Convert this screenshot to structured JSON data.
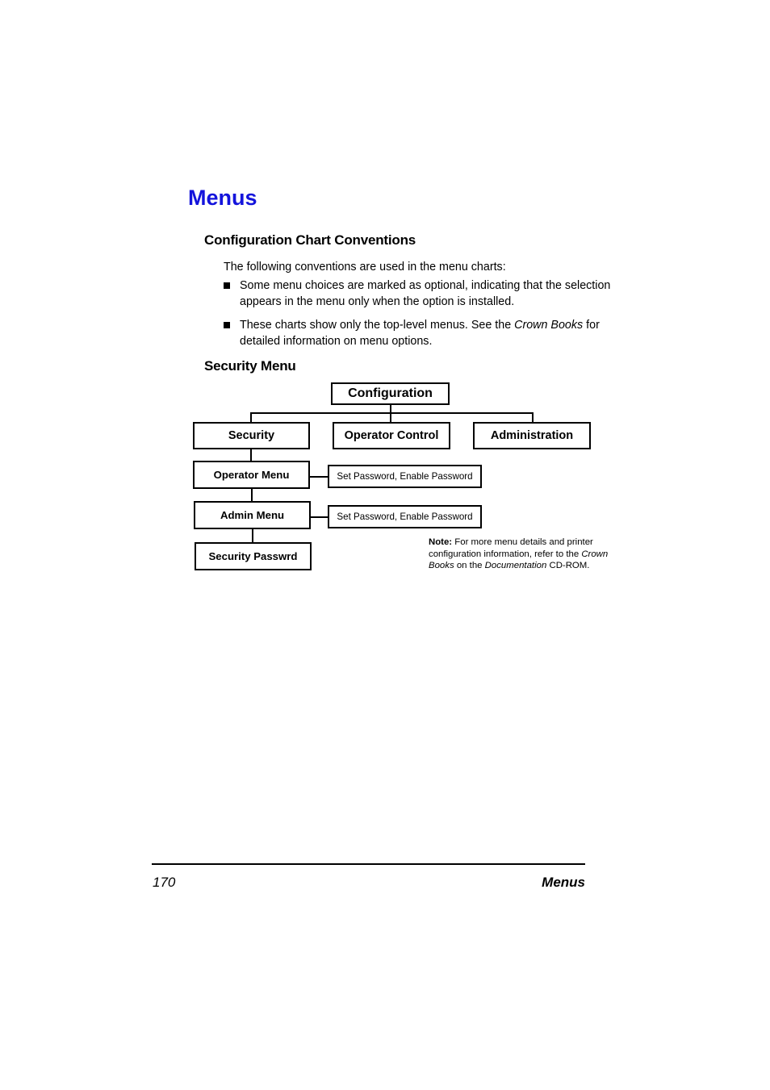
{
  "document": {
    "title": "Menus",
    "title_color": "#1414dc"
  },
  "sections": {
    "conventions": {
      "heading": "Configuration Chart Conventions",
      "intro": "The following conventions are used in the menu charts:",
      "bullets": [
        {
          "prefix": "Some menu choices are marked as optional, indicating that the selection appears in the menu only when the option is installed.",
          "italic": "",
          "suffix": ""
        },
        {
          "prefix": "These charts show only the top-level menus. See the ",
          "italic": "Crown Books",
          "suffix": " for detailed information on menu options."
        }
      ]
    },
    "security_menu": {
      "heading": "Security Menu"
    }
  },
  "chart_data": {
    "type": "diagram",
    "title": "Security Menu",
    "nodes": [
      {
        "id": "configuration",
        "label": "Configuration",
        "level": 0,
        "style": "bold"
      },
      {
        "id": "security",
        "label": "Security",
        "level": 1,
        "style": "bold"
      },
      {
        "id": "operator-control",
        "label": "Operator Control",
        "level": 1,
        "style": "bold"
      },
      {
        "id": "administration",
        "label": "Administration",
        "level": 1,
        "style": "bold"
      },
      {
        "id": "operator-menu",
        "label": "Operator Menu",
        "level": 2,
        "style": "bold"
      },
      {
        "id": "admin-menu",
        "label": "Admin Menu",
        "level": 3,
        "style": "bold"
      },
      {
        "id": "security-passwrd",
        "label": "Security Passwrd",
        "level": 4,
        "style": "bold"
      },
      {
        "id": "operator-options",
        "label": "Set Password, Enable Password",
        "level": 2,
        "style": "plain"
      },
      {
        "id": "admin-options",
        "label": "Set Password, Enable Password",
        "level": 3,
        "style": "plain"
      }
    ],
    "edges": [
      {
        "from": "configuration",
        "to": "security"
      },
      {
        "from": "configuration",
        "to": "operator-control"
      },
      {
        "from": "configuration",
        "to": "administration"
      },
      {
        "from": "security",
        "to": "operator-menu"
      },
      {
        "from": "operator-menu",
        "to": "admin-menu"
      },
      {
        "from": "admin-menu",
        "to": "security-passwrd"
      },
      {
        "from": "operator-menu",
        "to": "operator-options"
      },
      {
        "from": "admin-menu",
        "to": "admin-options"
      }
    ]
  },
  "note": {
    "label": "Note:",
    "part1": " For more menu details and printer configuration information, refer to the ",
    "italic1": "Crown Books",
    "part2": " on the ",
    "italic2": "Documentation",
    "part3": " CD-ROM."
  },
  "footer": {
    "page_number": "170",
    "section_label": "Menus"
  }
}
